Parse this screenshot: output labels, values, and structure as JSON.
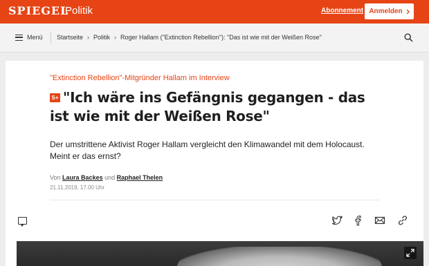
{
  "header": {
    "logo": "SPIEGEL",
    "section": "Politik",
    "subscription_link": "Abonnement",
    "login_button": "Anmelden",
    "brand_color": "#e64415"
  },
  "nav": {
    "menu_label": "Menü",
    "breadcrumbs": [
      "Startseite",
      "Politik",
      "Roger Hallam (\"Extinction Rebellion\"): \"Das ist wie mit der Weißen Rose\""
    ]
  },
  "article": {
    "kicker": "\"Extinction Rebellion\"-Mitgründer Hallam im Interview",
    "badge": "S+",
    "headline": "\"Ich wäre ins Gefängnis gegangen - das ist wie mit der Weißen Rose\"",
    "teaser": "Der umstrittene Aktivist Roger Hallam vergleicht den Klimawandel mit dem Holocaust. Meint er das ernst?",
    "byline_prefix": "Von",
    "author_1": "Laura Backes",
    "byline_joiner": "und",
    "author_2": "Raphael Thelen",
    "date": "21.11.2019, 17.00 Uhr"
  },
  "actions": {
    "icons": [
      "comment-icon",
      "twitter-icon",
      "facebook-icon",
      "email-icon",
      "link-icon"
    ]
  }
}
